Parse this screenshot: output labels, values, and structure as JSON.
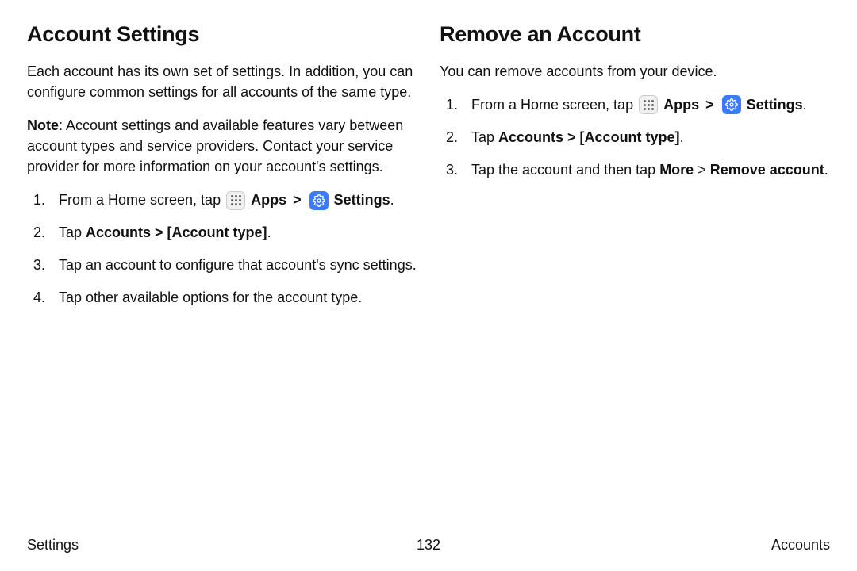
{
  "left": {
    "heading": "Account Settings",
    "intro": "Each account has its own set of settings. In addition, you can configure common settings for all accounts of the same type.",
    "note_label": "Note",
    "note_body": ": Account settings and available features vary between account types and service providers. Contact your service provider for more information on your account's settings.",
    "step1_pre": "From a Home screen, tap ",
    "apps_label": "Apps",
    "settings_label": "Settings",
    "period": ".",
    "step2_pre": "Tap ",
    "step2_bold": "Accounts > [Account type]",
    "step3": "Tap an account to configure that account's sync settings.",
    "step4": "Tap other available options for the account type."
  },
  "right": {
    "heading": "Remove an Account",
    "intro": "You can remove accounts from your device.",
    "step1_pre": "From a Home screen, tap ",
    "apps_label": "Apps",
    "settings_label": "Settings",
    "period": ".",
    "step2_pre": "Tap ",
    "step2_bold": "Accounts > [Account type]",
    "step3_pre": "Tap the account and then tap ",
    "step3_more": "More",
    "step3_chev": " > ",
    "step3_remove": "Remove account",
    "step3_post": "."
  },
  "footer": {
    "left": "Settings",
    "center": "132",
    "right": "Accounts"
  },
  "chevron": " > "
}
